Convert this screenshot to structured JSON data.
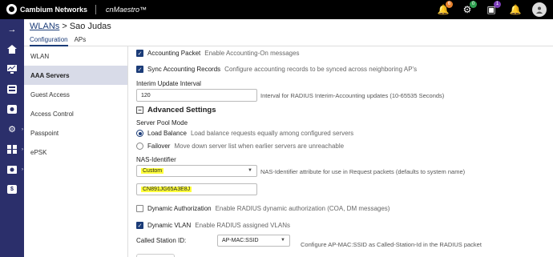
{
  "topbar": {
    "brand": "Cambium Networks",
    "product": "cnMaestro™",
    "icons": [
      {
        "name": "alarm-bell-icon",
        "glyph": "🔔",
        "badge": "6",
        "badge_color": "#e8822e"
      },
      {
        "name": "events-icon",
        "glyph": "⚙",
        "badge": "0",
        "badge_color": "#2e9e4f"
      },
      {
        "name": "terminal-icon",
        "glyph": "▣",
        "badge": "1",
        "badge_color": "#7b3db6"
      },
      {
        "name": "notification-icon",
        "glyph": "🔔",
        "badge": "",
        "badge_color": ""
      }
    ]
  },
  "rail": {
    "items": [
      "collapse-arrow-icon",
      "home-icon",
      "monitor-icon",
      "devices-icon",
      "wireless-icon",
      "settings-icon",
      "apps-icon",
      "tools-icon",
      "billing-icon"
    ]
  },
  "header": {
    "breadcrumb_link": "WLANs",
    "breadcrumb_current": " > Sao Judas",
    "tabs": [
      "Configuration",
      "APs"
    ]
  },
  "subnav": {
    "items": [
      "WLAN",
      "AAA Servers",
      "Guest Access",
      "Access Control",
      "Passpoint",
      "ePSK"
    ],
    "active": "AAA Servers"
  },
  "main": {
    "accounting_packet": {
      "label": "Accounting Packet",
      "desc": "Enable Accounting-On messages",
      "checked": true
    },
    "sync_accounting": {
      "label": "Sync Accounting Records",
      "desc": "Configure accounting records to be synced across neighboring AP's",
      "checked": true
    },
    "interim": {
      "label": "Interim Update Interval",
      "value": "120",
      "desc": "Interval for RADIUS Interim-Accounting updates (10-65535 Seconds)"
    },
    "advanced_title": "Advanced Settings",
    "server_pool": {
      "label": "Server Pool Mode",
      "load_balance": {
        "label": "Load Balance",
        "desc": "Load balance requests equally among configured servers",
        "selected": true
      },
      "failover": {
        "label": "Failover",
        "desc": "Move down server list when earlier servers are unreachable",
        "selected": false
      }
    },
    "nas": {
      "label": "NAS-Identifier",
      "selected": "Custom",
      "desc": "NAS-Identifier attribute for use in Request packets (defaults to system name)",
      "custom_value": "CN891JG65A3E8J"
    },
    "dynamic_auth": {
      "label": "Dynamic Authorization",
      "desc": "Enable RADIUS dynamic authorization (COA, DM messages)",
      "checked": false
    },
    "dynamic_vlan": {
      "label": "Dynamic VLAN",
      "desc": "Enable RADIUS assigned VLANs",
      "checked": true
    },
    "called_station": {
      "label": "Called Station ID:",
      "selected": "AP-MAC:SSID",
      "desc": "Configure AP-MAC:SSID as Called-Station-Id in the RADIUS packet"
    }
  },
  "colors": {
    "rail": "#2b2f6b",
    "accent": "#1b3c78",
    "highlight": "#ffff3a"
  }
}
